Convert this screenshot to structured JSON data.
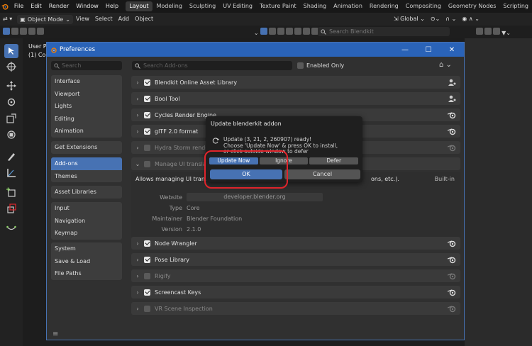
{
  "topbar": {
    "menus": [
      "File",
      "Edit",
      "Render",
      "Window",
      "Help"
    ],
    "workspaces": [
      "Layout",
      "Modeling",
      "Sculpting",
      "UV Editing",
      "Texture Paint",
      "Shading",
      "Animation",
      "Rendering",
      "Compositing",
      "Geometry Nodes",
      "Scripting"
    ],
    "active_workspace": "Layout"
  },
  "header2": {
    "mode": "Object Mode",
    "menus": [
      "View",
      "Select",
      "Add",
      "Object"
    ],
    "transform_orientation": "Global"
  },
  "header3": {
    "search_placeholder": "Search Blendkit"
  },
  "viewport": {
    "label_line1": "User P",
    "label_line2": "(1) Co"
  },
  "preferences": {
    "title": "Preferences",
    "sidebar_search_placeholder": "Search",
    "sidebar_groups": [
      [
        "Interface",
        "Viewport",
        "Lights",
        "Editing",
        "Animation"
      ],
      [
        "Get Extensions"
      ],
      [
        "Add-ons",
        "Themes"
      ],
      [
        "Asset Libraries"
      ],
      [
        "Input",
        "Navigation",
        "Keymap"
      ],
      [
        "System",
        "Save & Load",
        "File Paths"
      ]
    ],
    "active_section": "Add-ons",
    "addon_search_placeholder": "Search Add-ons",
    "enabled_only_label": "Enabled Only",
    "addons": [
      {
        "name": "Blendkit Online Asset Library",
        "enabled": true,
        "icon": "user-icon"
      },
      {
        "name": "Bool Tool",
        "enabled": true,
        "icon": "user-icon"
      },
      {
        "name": "Cycles Render Engine",
        "enabled": true,
        "icon": "blender-icon"
      },
      {
        "name": "glTF 2.0 format",
        "enabled": true,
        "icon": "blender-icon"
      },
      {
        "name": "Hydra Storm render e",
        "enabled": false,
        "icon": "blender-icon"
      }
    ],
    "expanded_addon": {
      "name": "Manage UI translatio",
      "enabled": false,
      "description_left": "Allows managing UI translati",
      "description_right": "ons, etc.).",
      "builtin": "Built-in",
      "website_label": "Website",
      "website_value": "developer.blender.org",
      "type_label": "Type",
      "type_value": "Core",
      "maintainer_label": "Maintainer",
      "maintainer_value": "Blender Foundation",
      "version_label": "Version",
      "version_value": "2.1.0"
    },
    "addons_after": [
      {
        "name": "Node Wrangler",
        "enabled": true,
        "icon": "blender-icon"
      },
      {
        "name": "Pose Library",
        "enabled": true,
        "icon": "blender-icon"
      },
      {
        "name": "Rigify",
        "enabled": false,
        "icon": "blender-icon"
      },
      {
        "name": "Screencast Keys",
        "enabled": true,
        "icon": "blender-icon"
      },
      {
        "name": "VR Scene Inspection",
        "enabled": false,
        "icon": "blender-icon"
      }
    ]
  },
  "popup": {
    "title": "Update blenderkit addon",
    "message": "Update (3, 21, 2, 260907) ready!\nChoose 'Update Now' & press OK to install,\nor click outside window to defer",
    "choices": [
      "Update Now",
      "Ignore",
      "Defer"
    ],
    "active_choice": "Update Now",
    "ok_label": "OK",
    "cancel_label": "Cancel"
  },
  "colors": {
    "accent": "#4772b3",
    "titlebar": "#2a63b8",
    "highlight": "#e0242b"
  }
}
